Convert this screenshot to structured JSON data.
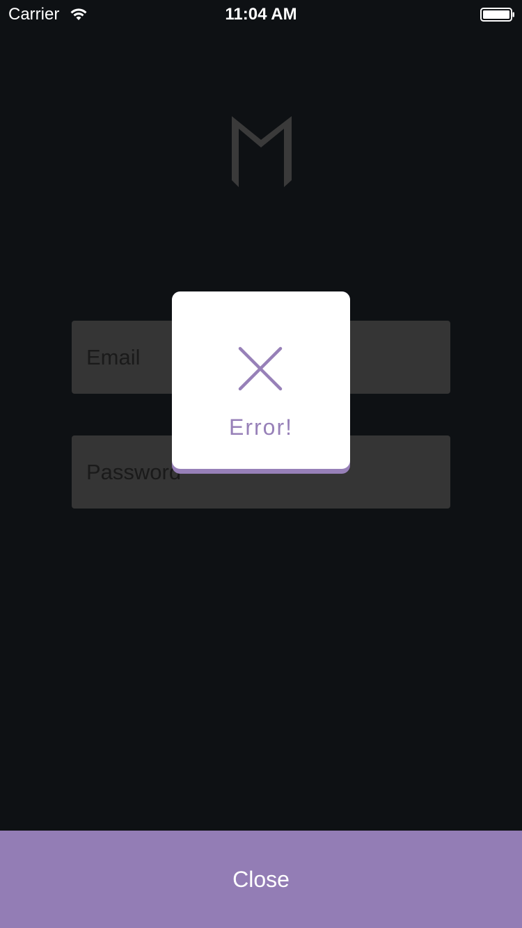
{
  "status_bar": {
    "carrier": "Carrier",
    "time": "11:04 AM",
    "wifi_icon": "wifi-icon",
    "battery_icon": "battery-full-icon"
  },
  "logo": {
    "icon": "m-logo-icon",
    "color": "#3a3a3a"
  },
  "form": {
    "email_placeholder": "Email",
    "password_placeholder": "Password",
    "field_background": "#353535"
  },
  "alert": {
    "icon": "close-x-icon",
    "title": "Error!",
    "accent_color": "#9780b8"
  },
  "footer": {
    "close_label": "Close",
    "background": "#937db5"
  },
  "colors": {
    "background": "#0e1114",
    "text_light": "#ffffff"
  }
}
